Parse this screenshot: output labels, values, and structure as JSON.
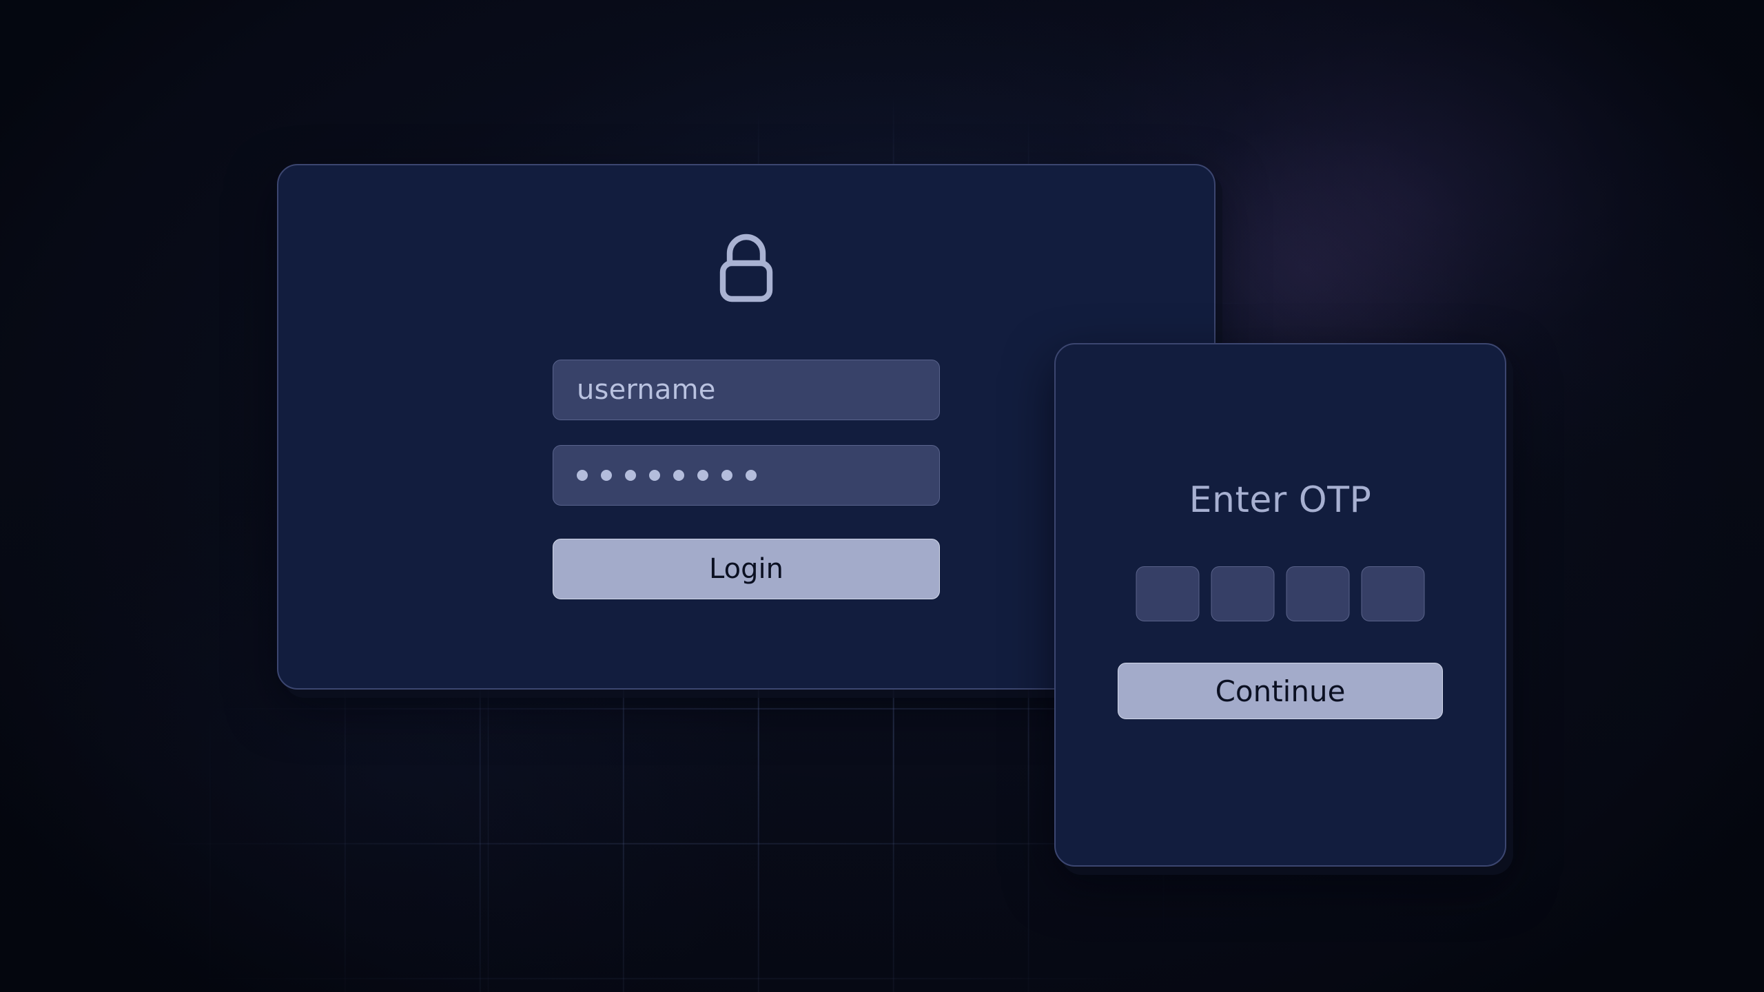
{
  "theme": {
    "page_background": "#0a0e1c",
    "card_background": "#121d3e",
    "card_border": "#3c4670",
    "field_background": "#384269",
    "field_border": "#59638c",
    "field_text": "#b9c2e0",
    "button_background": "#a3abca",
    "button_border": "#d2d8ea",
    "button_text": "#0b1022",
    "heading_text": "#a7b0d1",
    "grid_line": "#768ccd"
  },
  "login_card": {
    "icon": "lock-icon",
    "username": {
      "placeholder": "username",
      "value": "username"
    },
    "password": {
      "masked_value": "••••••••",
      "dot_count": 8
    },
    "submit_label": "Login"
  },
  "otp_card": {
    "title": "Enter OTP",
    "inputs": [
      {
        "value": ""
      },
      {
        "value": ""
      },
      {
        "value": ""
      },
      {
        "value": ""
      }
    ],
    "input_count": 4,
    "submit_label": "Continue"
  }
}
